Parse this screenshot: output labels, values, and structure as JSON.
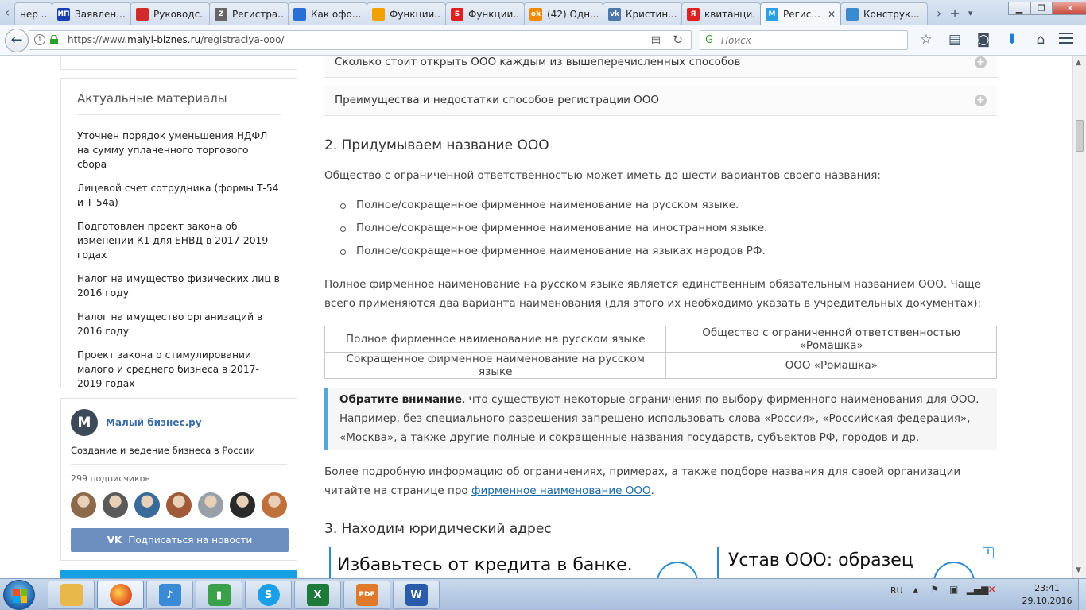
{
  "browser": {
    "tabs": [
      {
        "label": "нер ...",
        "fav_text": "",
        "fav_color": "#c8c8c8"
      },
      {
        "label": "Заявлен...",
        "fav_text": "ИП",
        "fav_color": "#1b3fb0"
      },
      {
        "label": "Руководс...",
        "fav_text": "",
        "fav_color": "#d22a2a"
      },
      {
        "label": "Регистра...",
        "fav_text": "Z",
        "fav_color": "#666666"
      },
      {
        "label": "Как офо...",
        "fav_text": "",
        "fav_color": "#2a6fd6"
      },
      {
        "label": "Функции...",
        "fav_text": "",
        "fav_color": "#f0a000"
      },
      {
        "label": "Функции...",
        "fav_text": "S",
        "fav_color": "#e02020"
      },
      {
        "label": "(42) Одн...",
        "fav_text": "ok",
        "fav_color": "#f08a00"
      },
      {
        "label": "Кристин...",
        "fav_text": "vk",
        "fav_color": "#4a76a8"
      },
      {
        "label": "квитанци...",
        "fav_text": "Я",
        "fav_color": "#e02020"
      },
      {
        "label": "Регис...",
        "fav_text": "М",
        "fav_color": "#2ba0e0",
        "active": true,
        "close": "✕"
      },
      {
        "label": "Конструк...",
        "fav_text": "",
        "fav_color": "#3a8ad0"
      }
    ],
    "url_prefix": "https://www.",
    "url_domain": "malyi-biznes.ru",
    "url_path": "/registraciya-ooo/",
    "search_placeholder": "Поиск"
  },
  "sidebar": {
    "materials_title": "Актуальные материалы",
    "materials": [
      "Уточнен порядок уменьшения НДФЛ на сумму уплаченного торгового сбора",
      "Лицевой счет сотрудника (формы Т-54 и Т-54а)",
      "Подготовлен проект закона об изменении К1 для ЕНВД в 2017-2019 годах",
      "Налог на имущество физических лиц в 2016 году",
      "Налог на имущество организаций в 2016 году",
      "Проект закона о стимулировании малого и среднего бизнеса в 2017-2019 годах"
    ],
    "vk": {
      "logo": "M",
      "name": "Малый бизнес.ру",
      "description": "Создание и ведение бизнеса в России",
      "subscribers": "299 подписчиков",
      "avatar_colors": [
        "#8a6a4a",
        "#5a5a5a",
        "#3a6a9a",
        "#a05a3a",
        "#9aa0a8",
        "#2a2a2a",
        "#c0703a"
      ],
      "button": "Подписаться на новости"
    }
  },
  "article": {
    "accordion": [
      "Сколько стоит открыть ООО каждым из вышеперечисленных способов",
      "Преимущества и недостатки способов регистрации ООО"
    ],
    "h2_name": "2. Придумываем название ООО",
    "p_variants": "Общество с ограниченной ответственностью может иметь до шести вариантов своего названия:",
    "bullets": [
      "Полное/сокращенное фирменное наименование на русском языке.",
      "Полное/сокращенное фирменное наименование на иностранном языке.",
      "Полное/сокращенное фирменное наименование на языках народов РФ."
    ],
    "p_full": "Полное фирменное наименование на русском языке является единственным обязательным названием ООО. Чаще всего применяются два варианта наименования (для этого их необходимо указать в учредительных документах):",
    "table": [
      [
        "Полное фирменное наименование на русском языке",
        "Общество с ограниченной ответственностью «Ромашка»"
      ],
      [
        "Сокращенное фирменное наименование на русском языке",
        "ООО «Ромашка»"
      ]
    ],
    "note_bold": "Обратите внимание",
    "note_text": ", что существуют некоторые ограничения по выбору фирменного наименования для ООО. Например, без специального разрешения запрещено использовать слова «Россия», «Российская федерация», «Москва», а также другие полные и сокращенные названия государств, субъектов РФ, городов и др.",
    "p_more_before": "Более подробную информацию об ограничениях, примерах, а также подборе названия для своей организации читайте на странице про ",
    "p_more_link": "фирменное наименование ООО",
    "p_more_after": ".",
    "h2_address": "3. Находим юридический адрес",
    "ad1": "Избавьтесь от кредита в банке.",
    "ad2": "Устав ООО: образец"
  },
  "taskbar": {
    "lang": "RU",
    "time": "23:41",
    "date": "29.10.2016",
    "apps": [
      {
        "name": "explorer",
        "color": "#e8b84a",
        "glyph": ""
      },
      {
        "name": "firefox",
        "color": "#e8662a",
        "glyph": ""
      },
      {
        "name": "music",
        "color": "#3a8ad6",
        "glyph": "♪"
      },
      {
        "name": "monitor",
        "color": "#3aa04a",
        "glyph": "▮"
      },
      {
        "name": "skype",
        "color": "#1aa0e8",
        "glyph": "S"
      },
      {
        "name": "excel",
        "color": "#1e7a3a",
        "glyph": "X"
      },
      {
        "name": "pdf",
        "color": "#e07a2a",
        "glyph": "PDF"
      },
      {
        "name": "word",
        "color": "#2a5aaa",
        "glyph": "W"
      }
    ]
  }
}
